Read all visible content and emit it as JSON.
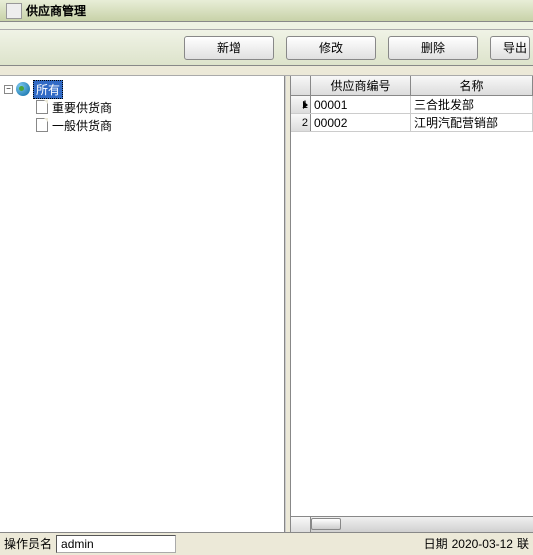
{
  "window": {
    "title": "供应商管理"
  },
  "toolbar": {
    "add": "新增",
    "edit": "修改",
    "delete": "删除",
    "export": "导出"
  },
  "tree": {
    "root": {
      "label": "所有"
    },
    "children": [
      {
        "label": "重要供货商"
      },
      {
        "label": "一般供货商"
      }
    ]
  },
  "grid": {
    "columns": {
      "c1": "供应商编号",
      "c2": "名称"
    },
    "rows": [
      {
        "num": "1",
        "id": "00001",
        "name": "三合批发部",
        "current": true
      },
      {
        "num": "2",
        "id": "00002",
        "name": "江明汽配营销部",
        "current": false
      }
    ]
  },
  "status": {
    "operator_label": "操作员名",
    "operator_value": "admin",
    "date_label": "日期",
    "date_value": "2020-03-12",
    "trailing": "联"
  }
}
